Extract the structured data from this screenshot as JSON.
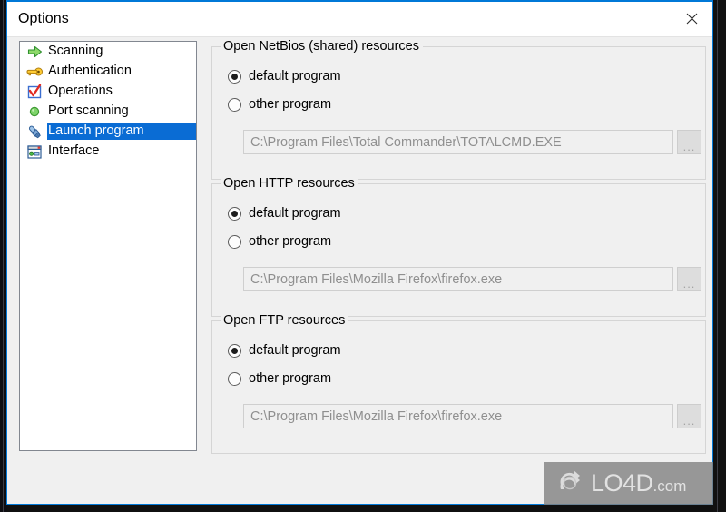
{
  "window": {
    "title": "Options",
    "close_label": "close-window",
    "accent_color": "#0078d7",
    "background_color": "#f0f0f0"
  },
  "sidebar": {
    "items": [
      {
        "label": "Scanning",
        "icon": "green-arrow-icon",
        "selected": false
      },
      {
        "label": "Authentication",
        "icon": "gold-key-icon",
        "selected": false
      },
      {
        "label": "Operations",
        "icon": "red-checkmark-icon",
        "selected": false
      },
      {
        "label": "Port scanning",
        "icon": "green-circle-icon",
        "selected": false
      },
      {
        "label": "Launch program",
        "icon": "blue-rocket-icon",
        "selected": true
      },
      {
        "label": "Interface",
        "icon": "interface-panel-icon",
        "selected": false
      }
    ],
    "selected_color": "#0a6cd4"
  },
  "main": {
    "groups": [
      {
        "legend": "Open NetBios (shared) resources",
        "options": [
          {
            "label": "default program",
            "checked": true
          },
          {
            "label": "other program",
            "checked": false
          }
        ],
        "path_value": "C:\\Program Files\\Total Commander\\TOTALCMD.EXE",
        "browse_label": "...",
        "disabled": true
      },
      {
        "legend": "Open HTTP resources",
        "options": [
          {
            "label": "default program",
            "checked": true
          },
          {
            "label": "other program",
            "checked": false
          }
        ],
        "path_value": "C:\\Program Files\\Mozilla Firefox\\firefox.exe",
        "browse_label": "...",
        "disabled": true
      },
      {
        "legend": "Open FTP resources",
        "options": [
          {
            "label": "default program",
            "checked": true
          },
          {
            "label": "other program",
            "checked": false
          }
        ],
        "path_value": "C:\\Program Files\\Mozilla Firefox\\firefox.exe",
        "browse_label": "...",
        "disabled": true
      }
    ]
  },
  "watermark": {
    "name": "LO4D",
    "suffix": ".com",
    "icon": "circular-arrows-icon"
  }
}
